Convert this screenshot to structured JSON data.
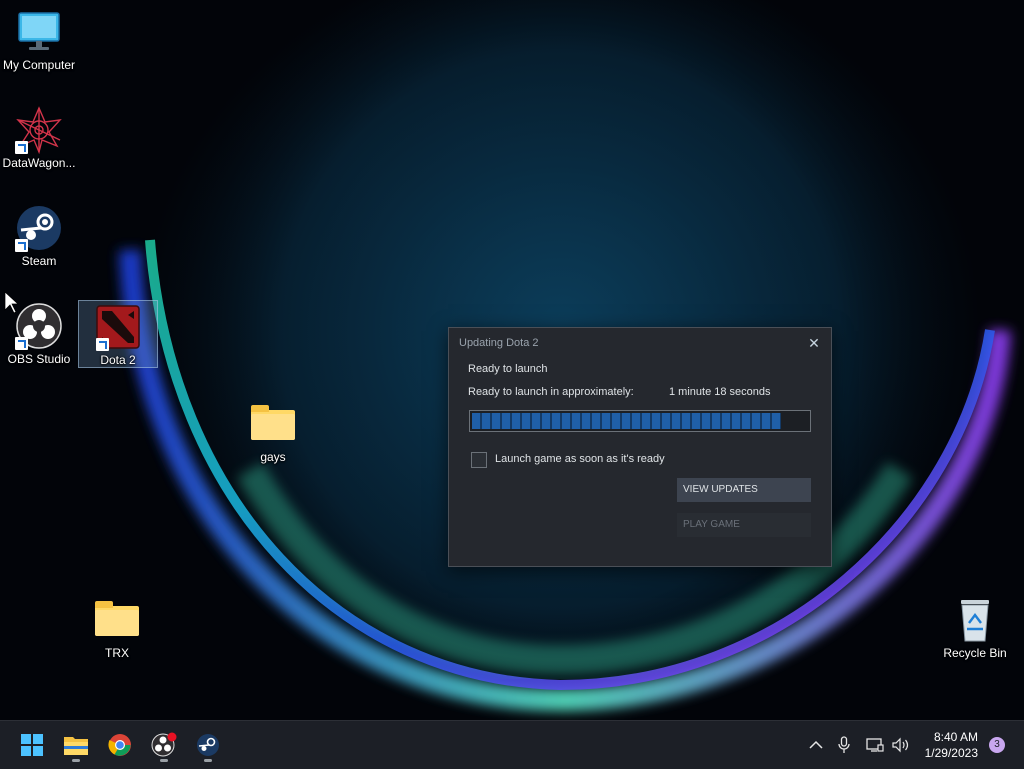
{
  "desktop": {
    "icons": [
      {
        "label": "My Computer"
      },
      {
        "label": "DataWagon..."
      },
      {
        "label": "Steam"
      },
      {
        "label": "OBS Studio"
      },
      {
        "label": "Dota 2"
      },
      {
        "label": "gays"
      },
      {
        "label": "TRX"
      },
      {
        "label": "Recycle Bin"
      }
    ]
  },
  "dialog": {
    "title": "Updating Dota 2",
    "close_icon": "close-icon",
    "status": "Ready to launch",
    "eta_label": "Ready to launch in approximately:",
    "eta_value": "1 minute 18 seconds",
    "progress_fraction": 0.92,
    "checkbox_label": "Launch game as soon as it's ready",
    "checkbox_checked": false,
    "view_updates_label": "VIEW UPDATES",
    "play_game_label": "PLAY GAME"
  },
  "taskbar": {
    "apps": [
      "start-icon",
      "file-explorer-icon",
      "chrome-icon",
      "obs-icon",
      "steam-icon"
    ],
    "tray": [
      "chevron-up-icon",
      "microphone-icon",
      "network-icon",
      "volume-icon"
    ],
    "time": "8:40 AM",
    "date": "1/29/2023",
    "notification_count": "3"
  },
  "colors": {
    "dialog_bg": "#25282e",
    "progress_fill": "#1f5fa8",
    "taskbar_bg": "#1c1f26"
  }
}
